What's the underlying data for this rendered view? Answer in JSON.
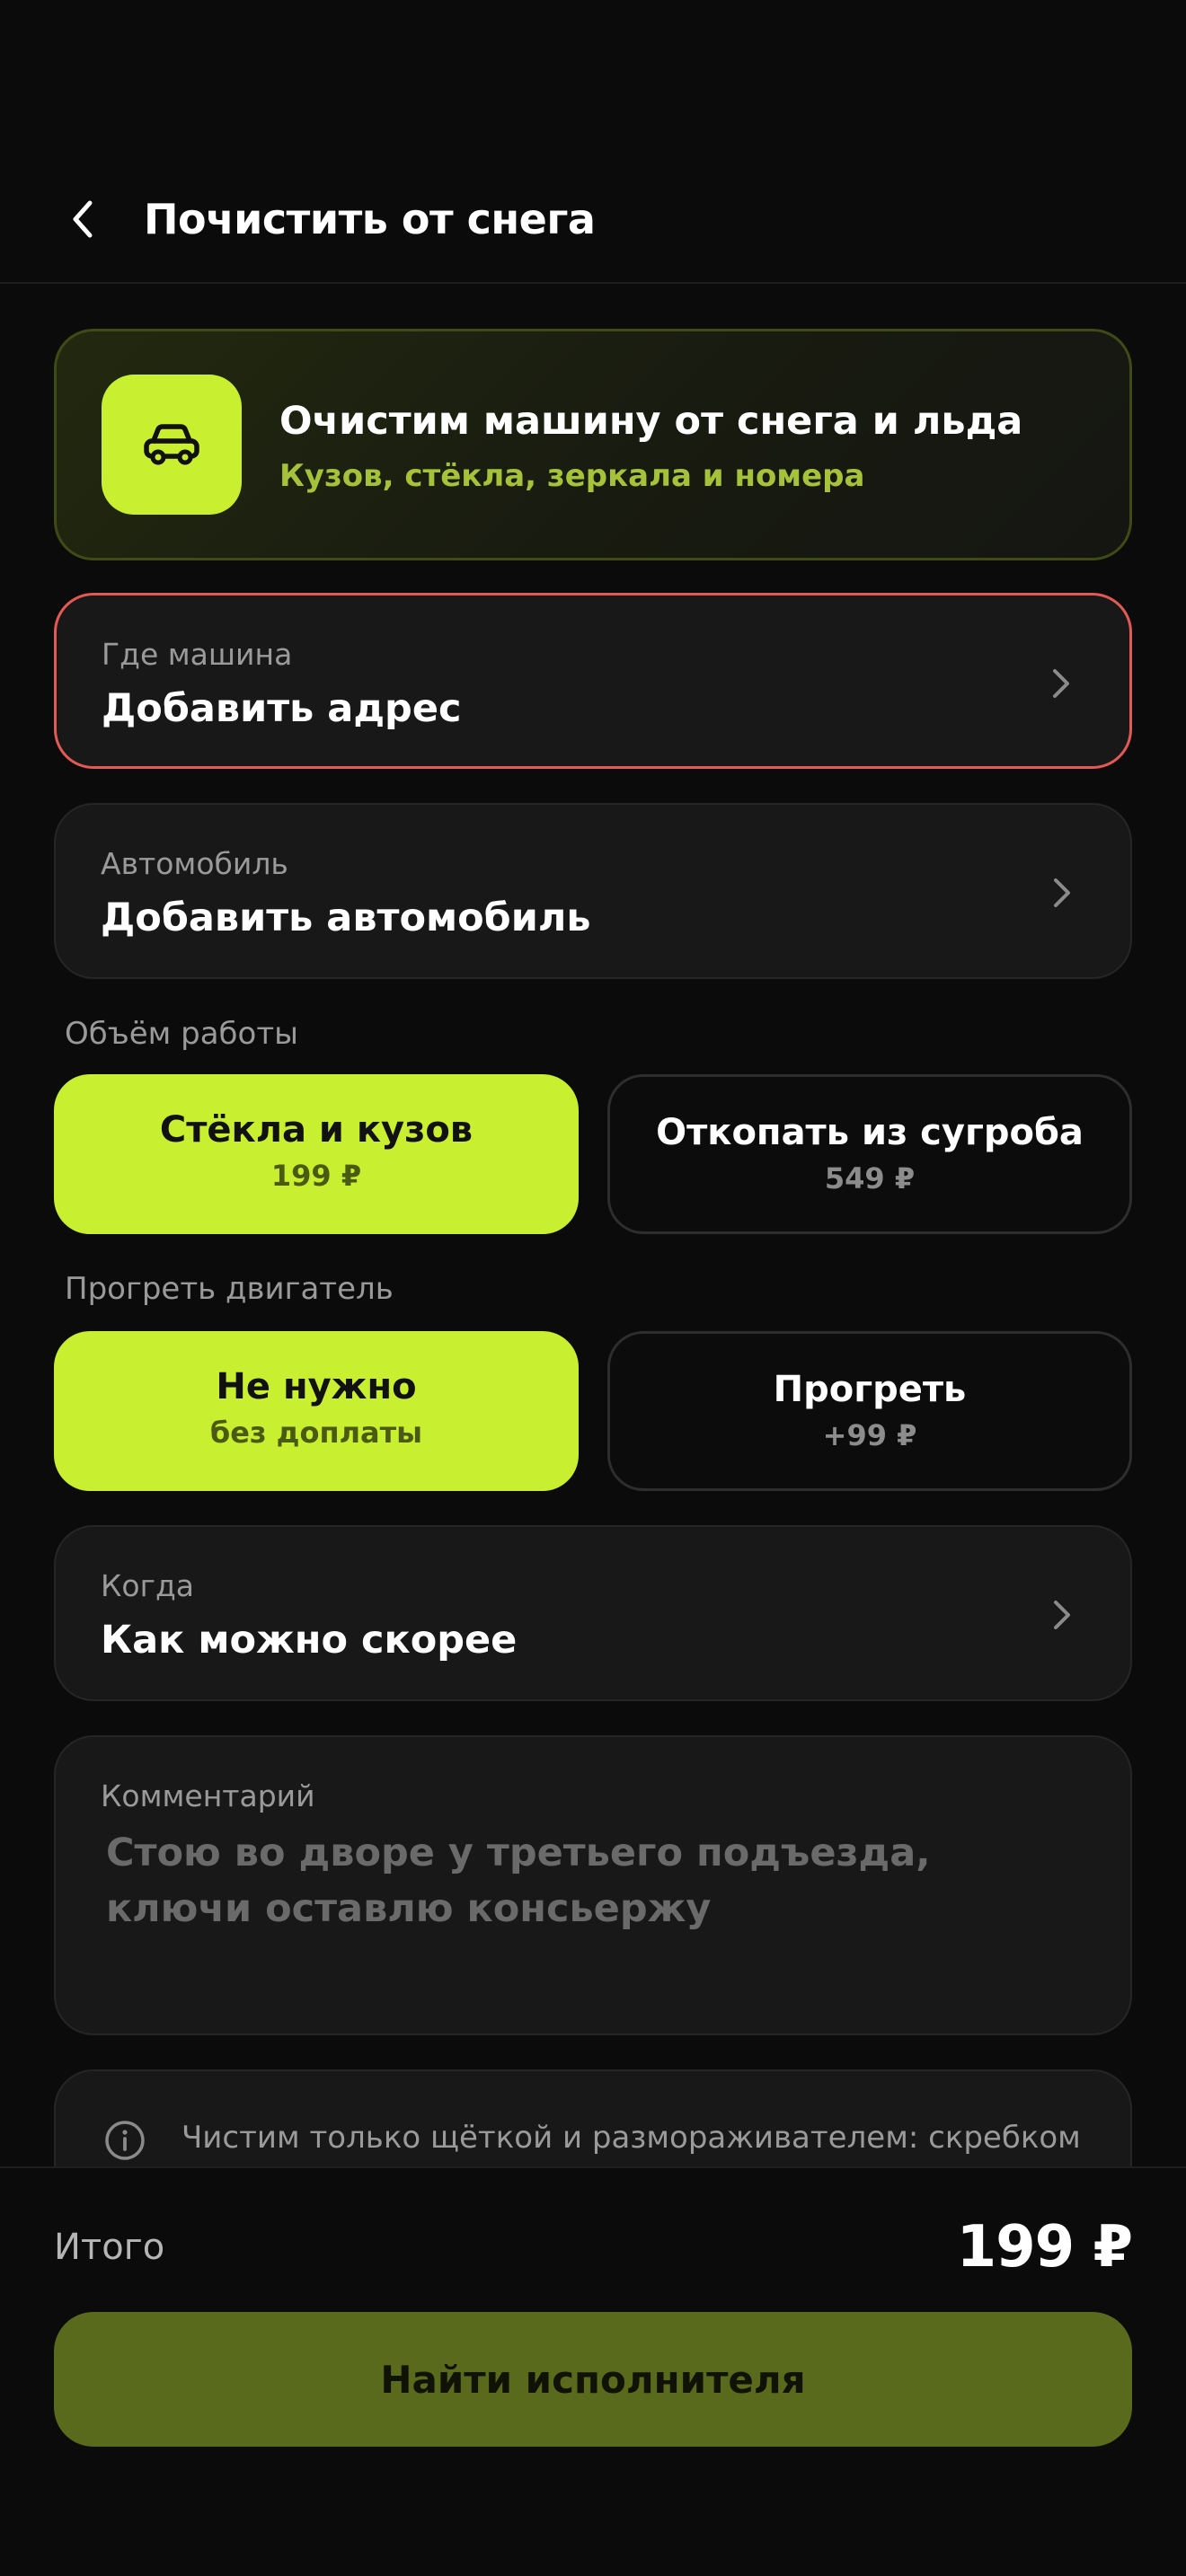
{
  "header": {
    "title": "Почистить от снега"
  },
  "promo": {
    "title": "Очистим машину от снега и льда",
    "subtitle": "Кузов, стёкла, зеркала и номера",
    "icon": "car-icon",
    "accent_color": "#c9ef31"
  },
  "location": {
    "label": "Где машина",
    "value": "Добавить адрес",
    "state": "error",
    "border_color": "#e25a55"
  },
  "vehicle": {
    "label": "Автомобиль",
    "value": "Добавить автомобиль"
  },
  "work_scope": {
    "label": "Объём работы",
    "options": [
      {
        "title": "Стёкла и кузов",
        "price": "199 ₽",
        "selected": true
      },
      {
        "title": "Откопать из сугроба",
        "price": "549 ₽",
        "selected": false
      }
    ]
  },
  "engine_warmup": {
    "label": "Прогреть двигатель",
    "options": [
      {
        "title": "Не нужно",
        "price": "без доплаты",
        "selected": true
      },
      {
        "title": "Прогреть",
        "price": "+99 ₽",
        "selected": false
      }
    ]
  },
  "timing": {
    "label": "Когда",
    "value": "Как можно скорее"
  },
  "comment": {
    "label": "Комментарий",
    "placeholder": "Стою во дворе у третьего подъезда, ключи оставлю консьержу"
  },
  "info": {
    "icon": "info-icon",
    "text": "Чистим только щёткой и размораживателем: скребком"
  },
  "footer": {
    "total_label": "Итого",
    "total_value": "199 ₽",
    "cta_label": "Найти исполнителя",
    "cta_color": "#5a6a1c"
  }
}
